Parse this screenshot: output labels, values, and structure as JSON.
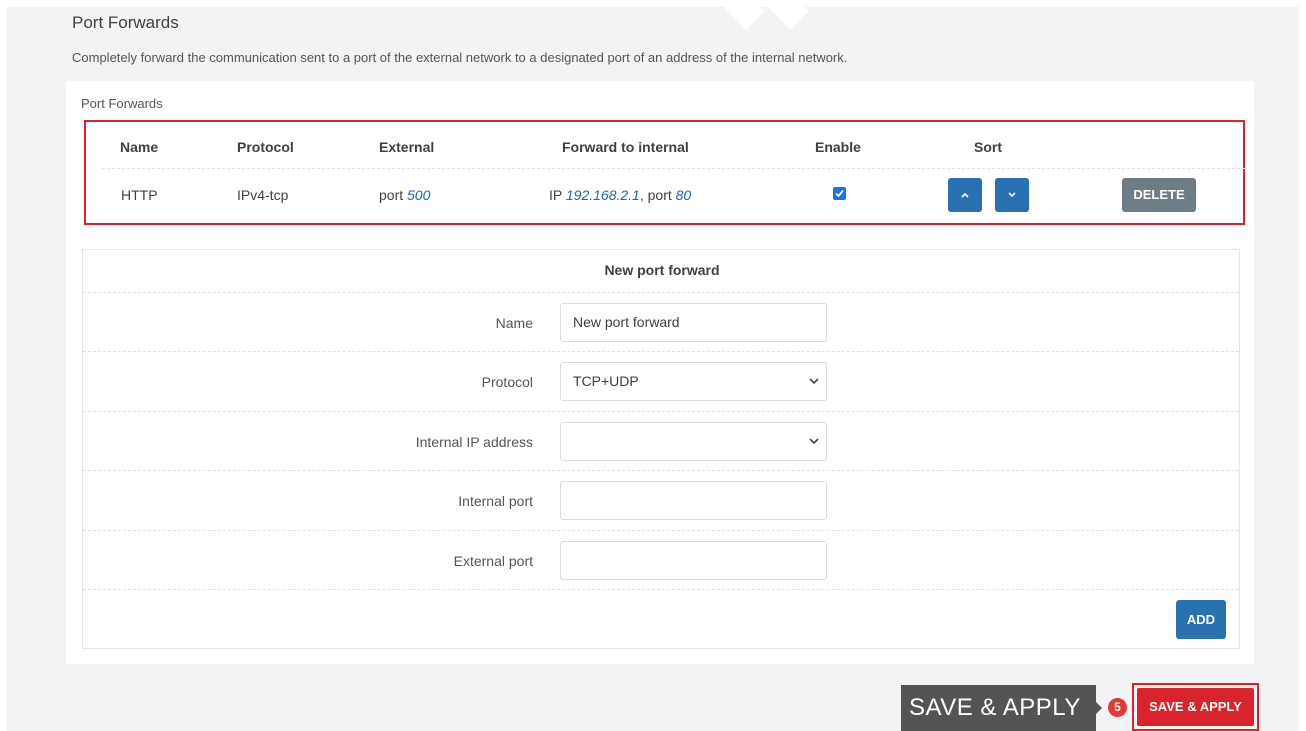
{
  "page": {
    "title": "Port Forwards",
    "description": "Completely forward the communication sent to a port of the external network to a designated port of an address of the internal network."
  },
  "card": {
    "title": "Port Forwards"
  },
  "table": {
    "headers": {
      "name": "Name",
      "protocol": "Protocol",
      "external": "External",
      "forward": "Forward to internal",
      "enable": "Enable",
      "sort": "Sort"
    },
    "rows": [
      {
        "name": "HTTP",
        "protocol": "IPv4-tcp",
        "external_prefix": "port",
        "external_port": "500",
        "ip_prefix": "IP",
        "ip": "192.168.2.1",
        "port_prefix": ", port",
        "internal_port": "80",
        "enabled": true,
        "delete_label": "DELETE"
      }
    ]
  },
  "new_forward": {
    "title": "New port forward",
    "fields": {
      "name": {
        "label": "Name",
        "value": "New port forward"
      },
      "protocol": {
        "label": "Protocol",
        "value": "TCP+UDP"
      },
      "internal_ip": {
        "label": "Internal IP address",
        "value": ""
      },
      "internal_port": {
        "label": "Internal port",
        "value": ""
      },
      "external_port": {
        "label": "External port",
        "value": ""
      }
    },
    "add_label": "ADD"
  },
  "footer": {
    "tooltip": "SAVE & APPLY",
    "step": "5",
    "save_label": "SAVE & APPLY"
  },
  "colors": {
    "accent": "#2a71b2",
    "highlight": "#d9232d",
    "save": "#d9232d",
    "checkbox": "#1a73e8",
    "delete": "#6e7c86"
  }
}
